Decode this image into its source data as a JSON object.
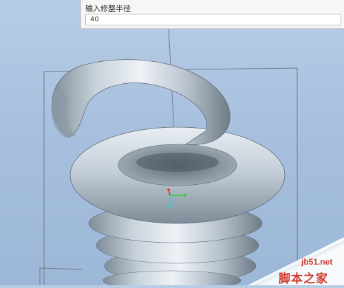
{
  "input_panel": {
    "label": "输入修整半径",
    "value": "40"
  },
  "viewport": {
    "background_colors": [
      "#b7cde6",
      "#9db7d8"
    ],
    "model": "spiral-spring-icon",
    "triad_icon": "coordinate-triad-icon"
  },
  "watermark": {
    "domain": "jb51.net",
    "name": "脚本之家",
    "color": "#d03b2d"
  }
}
